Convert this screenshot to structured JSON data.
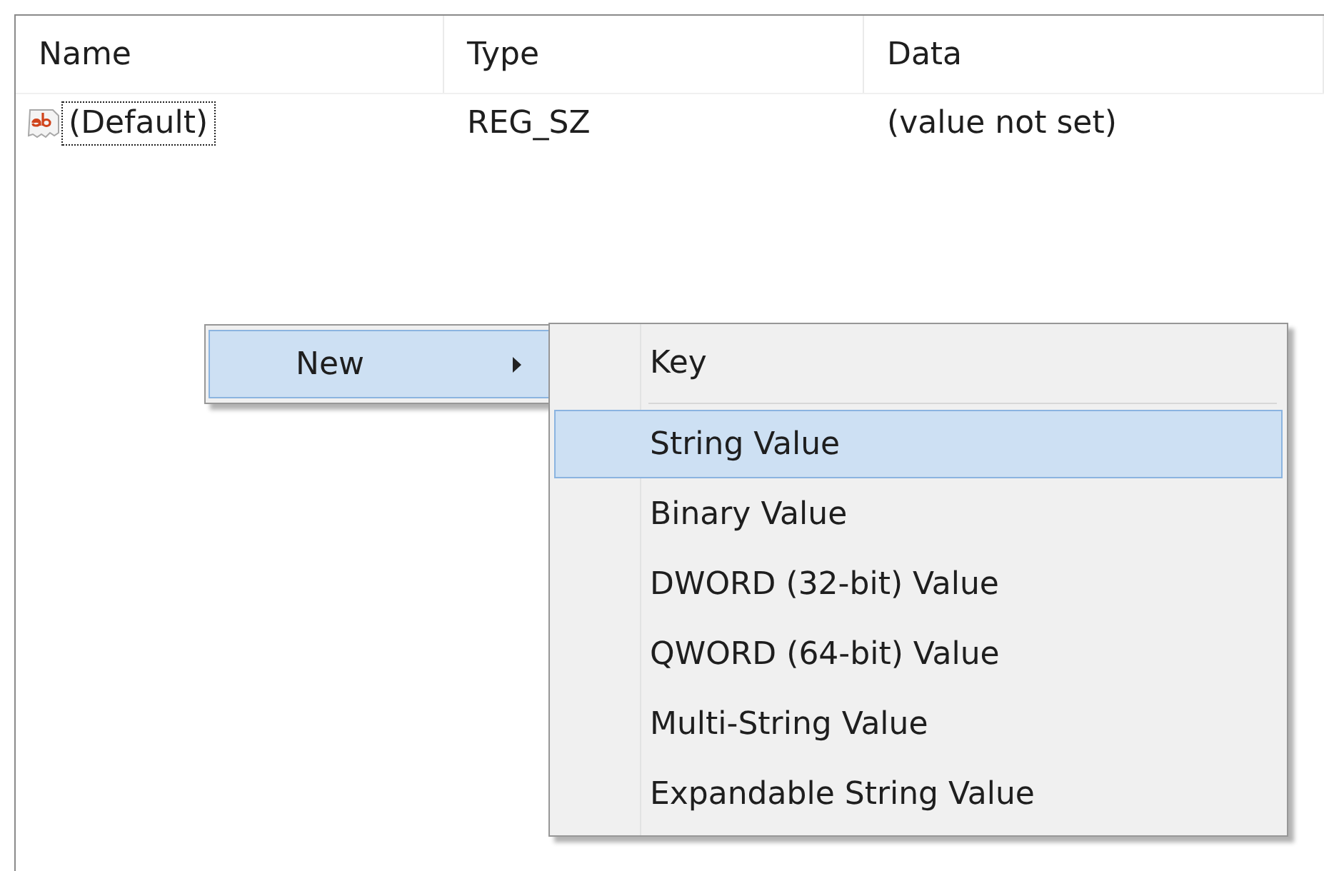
{
  "list": {
    "columns": [
      "Name",
      "Type",
      "Data"
    ],
    "rows": [
      {
        "name": "(Default)",
        "type": "REG_SZ",
        "data": "(value not set)",
        "focused": true
      }
    ]
  },
  "context_menu": {
    "items": [
      {
        "label": "New",
        "selected": true,
        "has_submenu": true
      }
    ]
  },
  "submenu": {
    "items": [
      {
        "kind": "item",
        "label": "Key",
        "selected": false
      },
      {
        "kind": "separator"
      },
      {
        "kind": "item",
        "label": "String Value",
        "selected": true
      },
      {
        "kind": "item",
        "label": "Binary Value",
        "selected": false
      },
      {
        "kind": "item",
        "label": "DWORD (32-bit) Value",
        "selected": false
      },
      {
        "kind": "item",
        "label": "QWORD (64-bit) Value",
        "selected": false
      },
      {
        "kind": "item",
        "label": "Multi-String Value",
        "selected": false
      },
      {
        "kind": "item",
        "label": "Expandable String Value",
        "selected": false
      }
    ]
  }
}
